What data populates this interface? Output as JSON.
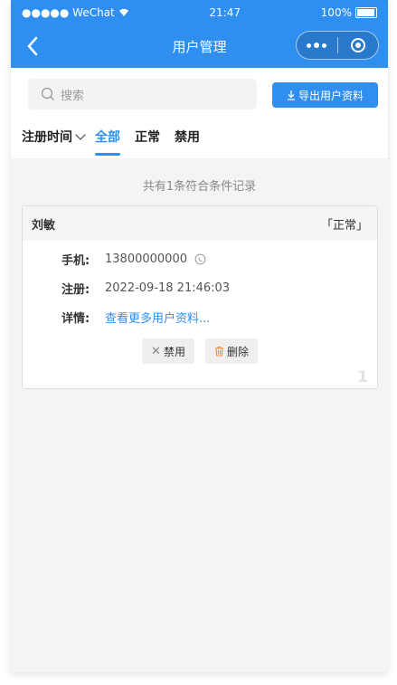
{
  "status_bar": {
    "carrier": "●●●●● WeChat",
    "time": "21:47",
    "battery": "100%"
  },
  "nav": {
    "title": "用户管理"
  },
  "search": {
    "placeholder": "搜索"
  },
  "export_button": {
    "label": "导出用户资料"
  },
  "tabs": {
    "sort_label": "注册时间",
    "items": [
      "全部",
      "正常",
      "禁用"
    ],
    "active": "全部"
  },
  "summary": "共有1条符合条件记录",
  "records": [
    {
      "name": "刘敏",
      "status": "「正常」",
      "phone_label": "手机:",
      "phone": "13800000000",
      "reg_label": "注册:",
      "reg_time": "2022-09-18 21:46:03",
      "detail_label": "详情:",
      "detail_link": "查看更多用户资料...",
      "ban_label": "禁用",
      "delete_label": "删除",
      "index": "1"
    }
  ],
  "colors": {
    "accent": "#2f8ff0",
    "delete_icon": "#f0902f"
  }
}
